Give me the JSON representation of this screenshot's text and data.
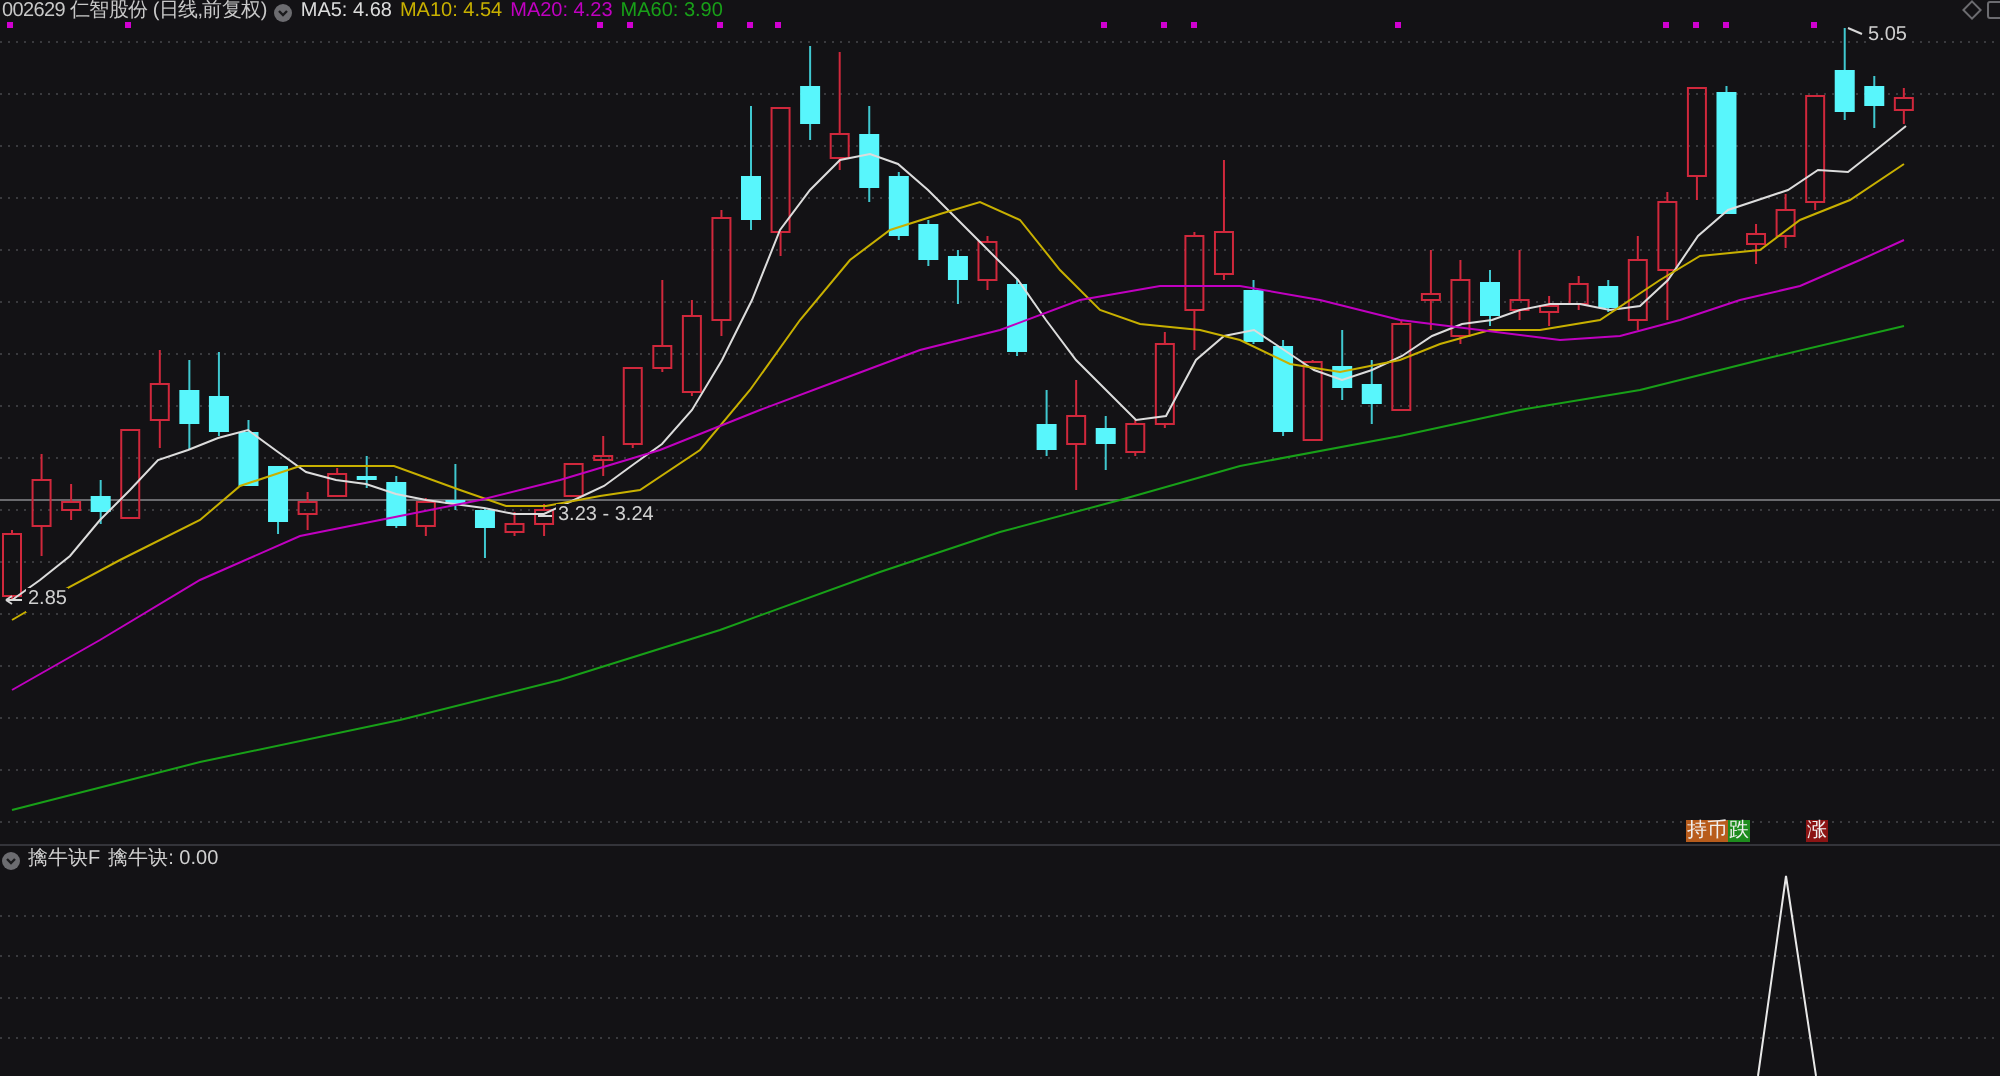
{
  "header": {
    "title": "002629 仁智股份 (日线,前复权)",
    "indicators": [
      {
        "label": "MA5: 4.68",
        "color": "#dcdcdc"
      },
      {
        "label": "MA10: 4.54",
        "color": "#c8b000"
      },
      {
        "label": "MA20: 4.23",
        "color": "#c000c0"
      },
      {
        "label": "MA60: 3.90",
        "color": "#18a018"
      }
    ]
  },
  "main_chart": {
    "price_labels": [
      {
        "kind": "low",
        "text": "2.85"
      },
      {
        "kind": "range",
        "text": "3.23 - 3.24"
      },
      {
        "kind": "high",
        "text": "5.05"
      }
    ],
    "signal_groups": [
      {
        "tags": [
          {
            "text": "持币",
            "color": "#b85c1c"
          },
          {
            "text": "跌",
            "color": "#1e8c1e"
          }
        ]
      },
      {
        "tags": [
          {
            "text": "涨",
            "color": "#8c1414"
          }
        ]
      }
    ]
  },
  "indicator_panel": {
    "title": "擒牛诀F",
    "reading": "擒牛诀: 0.00"
  }
}
